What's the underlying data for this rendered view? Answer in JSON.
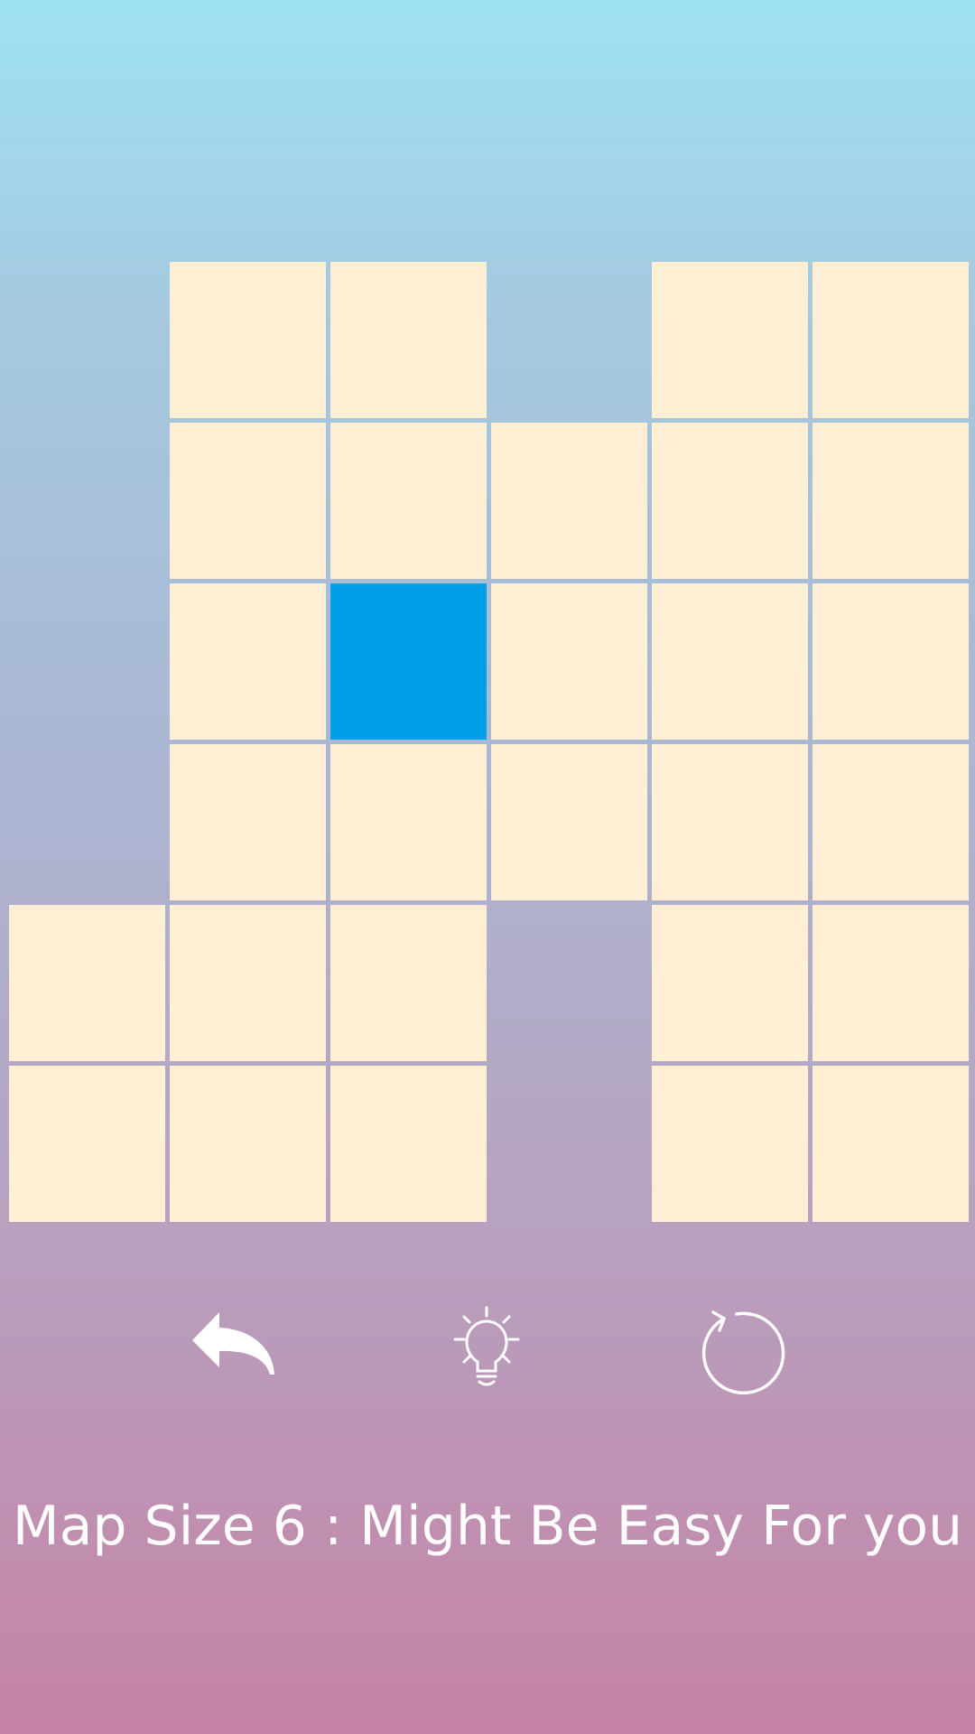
{
  "game": {
    "message": "Map Size 6 : Might Be Easy For you",
    "grid": {
      "rows": 6,
      "cols": 6,
      "cells": [
        [
          0,
          1,
          1,
          0,
          1,
          1
        ],
        [
          0,
          1,
          1,
          1,
          1,
          1
        ],
        [
          0,
          1,
          2,
          1,
          1,
          1
        ],
        [
          0,
          1,
          1,
          1,
          1,
          1
        ],
        [
          1,
          1,
          1,
          0,
          1,
          1
        ],
        [
          1,
          1,
          1,
          0,
          1,
          1
        ]
      ],
      "legend": {
        "0": "empty",
        "1": "tile",
        "2": "player"
      }
    },
    "controls": [
      {
        "name": "undo-button",
        "icon": "undo-arrow-icon"
      },
      {
        "name": "hint-button",
        "icon": "lightbulb-icon"
      },
      {
        "name": "restart-button",
        "icon": "restart-icon"
      }
    ],
    "colors": {
      "tile": "#ffefd5",
      "player": "#009fe8",
      "icon": "#ffffff",
      "text": "#ffffff"
    }
  }
}
